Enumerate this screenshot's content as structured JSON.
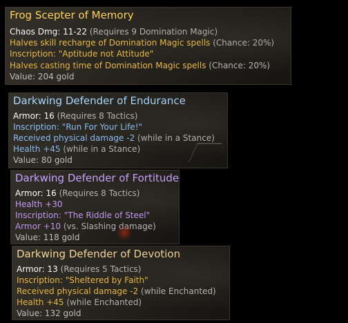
{
  "tooltips": [
    {
      "title": "Frog Scepter of Memory",
      "lines": [
        {
          "main": "Chaos Dmg: 11-22",
          "note": " (Requires 9 Domination Magic)"
        },
        {
          "main": "Halves skill recharge of Domination Magic spells",
          "note": " (Chance: 20%)"
        },
        {
          "main": "Inscription: \"Aptitude not Attitude\"",
          "note": ""
        },
        {
          "main": "Halves casting time of Domination Magic spells",
          "note": " (Chance: 20%)"
        },
        {
          "main": "Value: 204 gold",
          "note": ""
        }
      ]
    },
    {
      "title": "Darkwing Defender of Endurance",
      "lines": [
        {
          "main": "Armor: 16",
          "note": " (Requires 8 Tactics)"
        },
        {
          "main": "Inscription: \"Run For Your Life!\"",
          "note": ""
        },
        {
          "main": "Received physical damage -2",
          "note": " (while in a Stance)"
        },
        {
          "main": "Health +45",
          "note": " (while in a Stance)"
        },
        {
          "main": "Value: 80 gold",
          "note": ""
        }
      ]
    },
    {
      "title": "Darkwing Defender of Fortitude",
      "lines": [
        {
          "main": "Armor: 16",
          "note": " (Requires 8 Tactics)"
        },
        {
          "main": "Health +30",
          "note": ""
        },
        {
          "main": "Inscription: \"The Riddle of Steel\"",
          "note": ""
        },
        {
          "main": "Armor +10",
          "note": " (vs. Slashing damage)"
        },
        {
          "main": "Value: 118 gold",
          "note": ""
        }
      ]
    },
    {
      "title": "Darkwing Defender of Devotion",
      "lines": [
        {
          "main": "Armor: 13",
          "note": " (Requires 5 Tactics)"
        },
        {
          "main": "Inscription: \"Sheltered by Faith\"",
          "note": ""
        },
        {
          "main": "Received physical damage -2",
          "note": " (while Enchanted)"
        },
        {
          "main": "Health +45",
          "note": " (while Enchanted)"
        },
        {
          "main": "Value: 132 gold",
          "note": ""
        }
      ]
    }
  ],
  "colors": {
    "gold_title": "#ffd25a",
    "blue_title": "#a6d8ff",
    "purple_title": "#c8a2ff",
    "orange_mod": "#f0c040",
    "blue_mod": "#8ec4ff",
    "purple_mod": "#c99cff"
  }
}
